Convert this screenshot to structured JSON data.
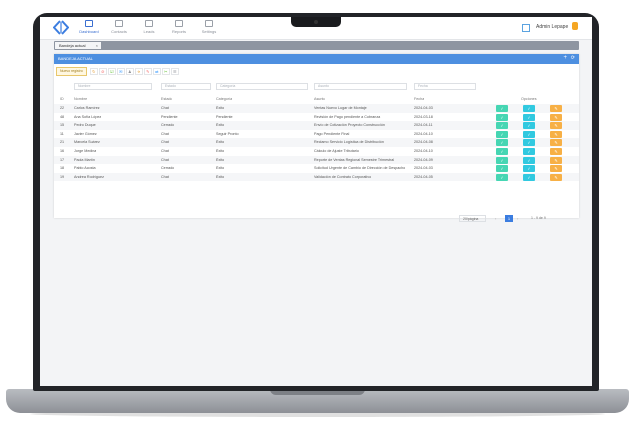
{
  "app": {
    "nav": [
      {
        "label": "Dashboard",
        "active": true
      },
      {
        "label": "Contacts"
      },
      {
        "label": "Leads"
      },
      {
        "label": "Reports"
      },
      {
        "label": "Settings"
      }
    ],
    "user_name": "Admin Lepape"
  },
  "tabs": [
    {
      "label": "Bandeja actual",
      "close": "×"
    }
  ],
  "panel": {
    "title": "BANDEJA ACTUAL",
    "add_icon": "+",
    "refresh_icon": "⟳"
  },
  "toolbar": {
    "new_label": "Nuevo registro",
    "buttons": [
      "↻",
      "⊘",
      "☑",
      "✉",
      "♟",
      "⟡",
      "✎",
      "⇄",
      "✂",
      "☰"
    ]
  },
  "filters": [
    {
      "placeholder": "Nombre"
    },
    {
      "placeholder": "Estado"
    },
    {
      "placeholder": "Categoría"
    },
    {
      "placeholder": "Asunto"
    },
    {
      "placeholder": "Fecha"
    }
  ],
  "table": {
    "columns": [
      "ID",
      "Nombre",
      "Estado",
      "Categoría",
      "Asunto",
      "Fecha",
      "Opciones"
    ],
    "rows": [
      {
        "id": "22",
        "nombre": "Carlos Ramírez",
        "estado": "Chat",
        "categoria": "Éxito",
        "asunto": "Ventas Nuevo Lugar de Montaje",
        "fecha": "2024-04-03"
      },
      {
        "id": "48",
        "nombre": "Ana Sofía López",
        "estado": "Pendiente",
        "categoria": "Pendiente",
        "asunto": "Revisión de Pago pendiente a Cobranza",
        "fecha": "2024-03-18"
      },
      {
        "id": "15",
        "nombre": "Pedro Duque",
        "estado": "Cerrado",
        "categoria": "Éxito",
        "asunto": "Envío de Cotización Proyecto Construcción",
        "fecha": "2024-04-11"
      },
      {
        "id": "11",
        "nombre": "Javier Gómez",
        "estado": "Chat",
        "categoria": "Seguir Pronto",
        "asunto": "Pago Pendiente Final",
        "fecha": "2024-04-10"
      },
      {
        "id": "21",
        "nombre": "Marcela Suárez",
        "estado": "Chat",
        "categoria": "Éxito",
        "asunto": "Reclamo Servicio Logística de Distribución",
        "fecha": "2024-04-08"
      },
      {
        "id": "16",
        "nombre": "Jorge Medina",
        "estado": "Chat",
        "categoria": "Éxito",
        "asunto": "Cálculo de Ajuste Tributario",
        "fecha": "2024-04-10"
      },
      {
        "id": "17",
        "nombre": "Paola Martín",
        "estado": "Chat",
        "categoria": "Éxito",
        "asunto": "Reporte de Ventas Regional Semestre Trimestral",
        "fecha": "2024-04-09"
      },
      {
        "id": "18",
        "nombre": "Pablo Acosta",
        "estado": "Cerrado",
        "categoria": "Éxito",
        "asunto": "Solicitud Urgente de Cambio de Dirección de Despacho",
        "fecha": "2024-04-03"
      },
      {
        "id": "19",
        "nombre": "Andrea Rodríguez",
        "estado": "Chat",
        "categoria": "Éxito",
        "asunto": "Validación de Contrato Corporativo",
        "fecha": "2024-04-05"
      }
    ],
    "action_icons": [
      "✓",
      "✓",
      "✎"
    ]
  },
  "pager": {
    "page_size": "20/página",
    "prev": "‹",
    "current": "1",
    "next": "›",
    "info": "1 - 9 de 9"
  },
  "colors": {
    "accent": "#4d8fe0",
    "action_green": "#46d6b3",
    "action_cyan": "#31c9e0",
    "action_orange": "#f7b046"
  }
}
